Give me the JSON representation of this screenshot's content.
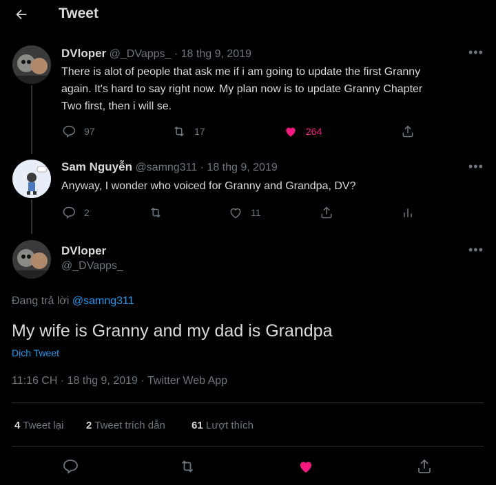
{
  "header": {
    "title": "Tweet"
  },
  "tweet1": {
    "name": "DVloper",
    "handle_date": "@_DVapps_ · 18 thg 9, 2019",
    "text_lines": [
      "There is alot of people that ask me if i am going to update the first Granny",
      "again. It's hard to say right now. My plan now is to update Granny Chapter",
      "Two first, then i will se."
    ],
    "replies": "97",
    "retweets": "17",
    "likes": "264"
  },
  "tweet2": {
    "name": "Sam Nguyễn",
    "handle_date": "@samng311 · 18 thg 9, 2019",
    "text": "Anyway, I wonder who voiced for Granny and Grandpa, DV?",
    "replies": "2",
    "likes": "11"
  },
  "main": {
    "name": "DVloper",
    "handle": "@_DVapps_",
    "replying_prefix": "Đang trả lời",
    "replying_to": "@samng311",
    "text": "My wife is Granny and my dad is Grandpa",
    "translate": "Dịch Tweet",
    "timestamp": "11:16 CH · 18 thg 9, 2019 · Twitter Web App",
    "stats": {
      "retweets_count": "4",
      "retweets_label": "Tweet lại",
      "quotes_count": "2",
      "quotes_label": "Tweet trích dẫn",
      "likes_count": "61",
      "likes_label": "Lượt thích"
    }
  },
  "colors": {
    "like": "#f91880",
    "link": "#1d9bf0",
    "background": "#000000"
  }
}
